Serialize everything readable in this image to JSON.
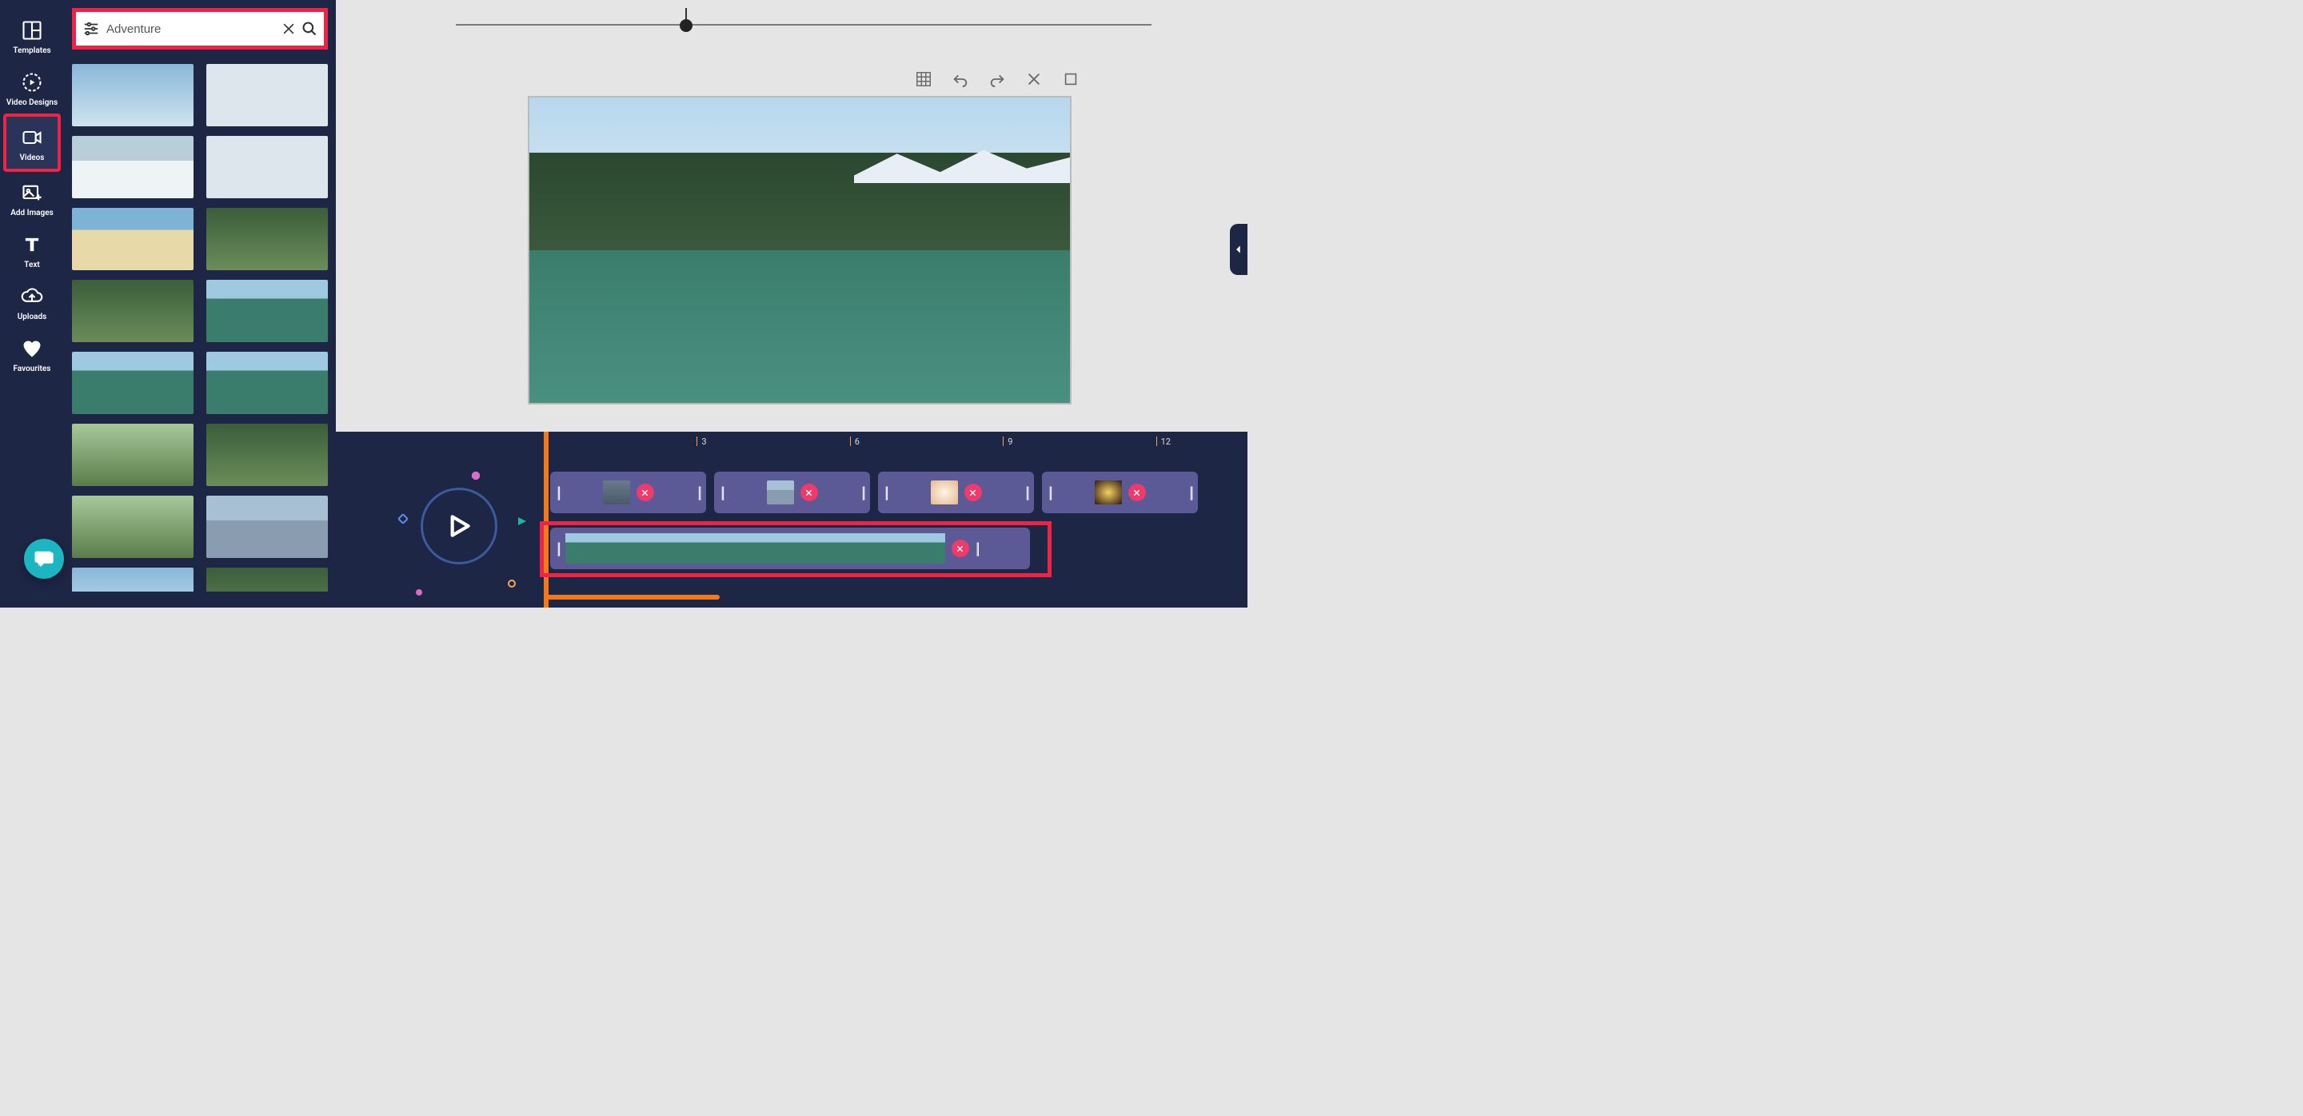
{
  "sidebar": {
    "items": [
      {
        "label": "Templates"
      },
      {
        "label": "Video Designs"
      },
      {
        "label": "Videos"
      },
      {
        "label": "Add Images"
      },
      {
        "label": "Text"
      },
      {
        "label": "Uploads"
      },
      {
        "label": "Favourites"
      }
    ],
    "active_index": 2,
    "highlighted_index": 2
  },
  "search": {
    "value": "Adventure"
  },
  "thumbnails": [
    {
      "scene": "scene-sky"
    },
    {
      "scene": "scene-snow"
    },
    {
      "scene": "scene-snow2"
    },
    {
      "scene": "scene-snow"
    },
    {
      "scene": "scene-beach"
    },
    {
      "scene": "scene-forest"
    },
    {
      "scene": "scene-forest"
    },
    {
      "scene": "scene-lake"
    },
    {
      "scene": "scene-lake"
    },
    {
      "scene": "scene-lake"
    },
    {
      "scene": "scene-park"
    },
    {
      "scene": "scene-forest"
    },
    {
      "scene": "scene-park"
    },
    {
      "scene": "scene-mtn"
    },
    {
      "scene": "scene-sky"
    },
    {
      "scene": "scene-forest"
    }
  ],
  "timeline": {
    "ruler_marks": [
      "3",
      "6",
      "9",
      "12"
    ],
    "clips_row1": [
      {
        "scene": "scene-city"
      },
      {
        "scene": "scene-mtn"
      },
      {
        "scene": "scene-flower"
      },
      {
        "scene": "scene-fire"
      }
    ],
    "clips_row2": [
      {
        "frames": 5,
        "scene": "scene-lake"
      }
    ]
  }
}
